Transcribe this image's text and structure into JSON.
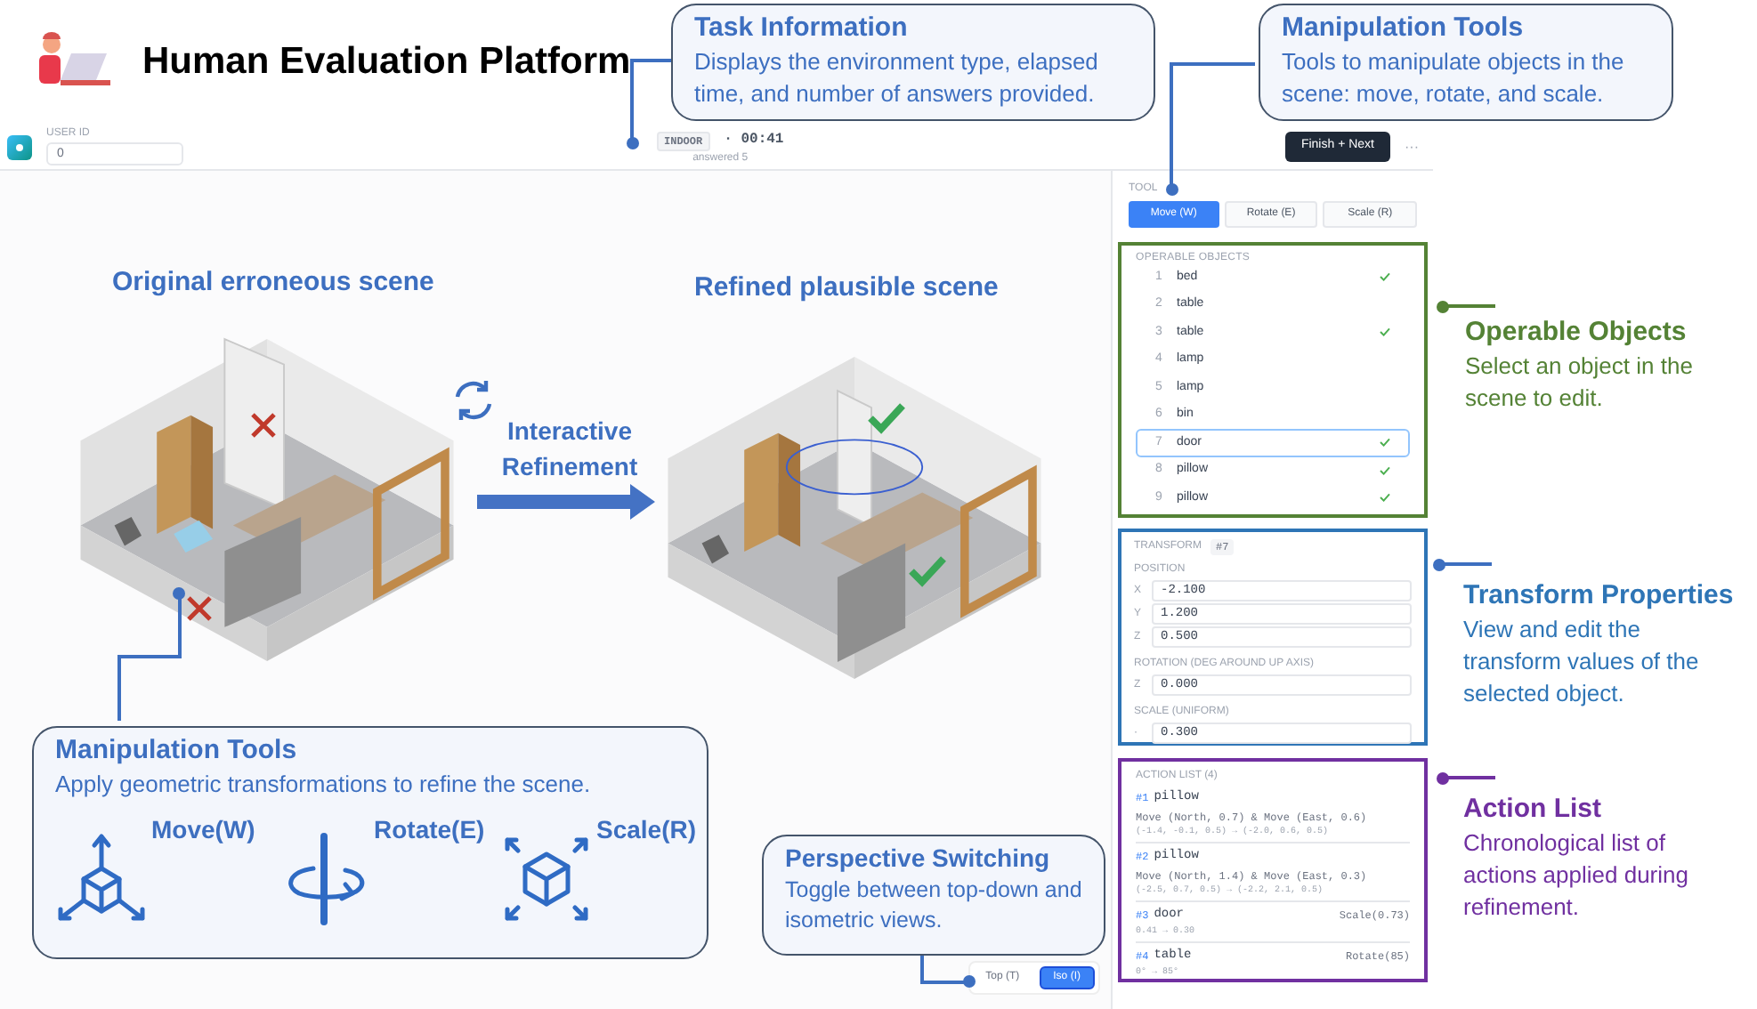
{
  "header": {
    "title": "Human Evaluation Platform"
  },
  "top_bar": {
    "user_id_label": "USER ID",
    "user_id_value": "0",
    "environment": "INDOOR",
    "timer": "· 00:41",
    "answered": "answered 5",
    "finish_button": "Finish + Next",
    "more": "···"
  },
  "scene": {
    "left_title": "Original erroneous scene",
    "right_title": "Refined plausible scene",
    "arrow_label": "Interactive Refinement"
  },
  "view_toggle": [
    {
      "label": "Top",
      "shortcut": "(T)",
      "selected": false
    },
    {
      "label": "Iso",
      "shortcut": "(I)",
      "selected": true
    }
  ],
  "tool": {
    "label": "TOOL",
    "tools": [
      {
        "label": "Move",
        "shortcut": "(W)",
        "selected": true
      },
      {
        "label": "Rotate",
        "shortcut": "(E)",
        "selected": false
      },
      {
        "label": "Scale",
        "shortcut": "(R)",
        "selected": false
      }
    ]
  },
  "objects": {
    "heading": "OPERABLE OBJECTS",
    "items": [
      {
        "index": "1",
        "name": "bed",
        "checked": true,
        "selected": false
      },
      {
        "index": "2",
        "name": "table",
        "checked": false,
        "selected": false
      },
      {
        "index": "3",
        "name": "table",
        "checked": true,
        "selected": false
      },
      {
        "index": "4",
        "name": "lamp",
        "checked": false,
        "selected": false
      },
      {
        "index": "5",
        "name": "lamp",
        "checked": false,
        "selected": false
      },
      {
        "index": "6",
        "name": "bin",
        "checked": false,
        "selected": false
      },
      {
        "index": "7",
        "name": "door",
        "checked": true,
        "selected": true
      },
      {
        "index": "8",
        "name": "pillow",
        "checked": true,
        "selected": false
      },
      {
        "index": "9",
        "name": "pillow",
        "checked": true,
        "selected": false
      }
    ]
  },
  "transform": {
    "label": "TRANSFORM",
    "badge": "#7",
    "position_label": "POSITION",
    "position": [
      {
        "axis": "X",
        "value": "-2.100"
      },
      {
        "axis": "Y",
        "value": "1.200"
      },
      {
        "axis": "Z",
        "value": "0.500"
      }
    ],
    "rotation_label": "ROTATION (DEG AROUND UP AXIS)",
    "rotation": {
      "axis": "Z",
      "value": "0.000"
    },
    "scale_label": "SCALE (UNIFORM)",
    "scale": {
      "axis": "·",
      "value": "0.300"
    }
  },
  "actions": {
    "heading": "ACTION LIST (4)",
    "items": [
      {
        "number": "#1",
        "object": "pillow",
        "detail": "Move (North, 0.7) & Move (East, 0.6)",
        "change": "(-1.4, -0.1, 0.5) → (-2.0, 0.6, 0.5)"
      },
      {
        "number": "#2",
        "object": "pillow",
        "detail": "Move (North, 1.4) & Move (East, 0.3)",
        "change": "(-2.5, 0.7, 0.5) → (-2.2, 2.1, 0.5)"
      },
      {
        "number": "#3",
        "object": "door",
        "operation": "Scale(0.73)",
        "change": "0.41 → 0.30"
      },
      {
        "number": "#4",
        "object": "table",
        "operation": "Rotate(85)",
        "change": "0° → 85°"
      }
    ]
  },
  "callouts": {
    "task_info": {
      "title": "Task Information",
      "text": "Displays the environment type, elapsed time, and number of answers provided."
    },
    "manipulation_panel": {
      "title": "Manipulation Tools",
      "text": "Tools to manipulate objects in the scene: move, rotate, and scale."
    },
    "operable_objects": {
      "title": "Operable Objects",
      "text": "Select an object in the scene to edit."
    },
    "transform_properties": {
      "title": "Transform Properties",
      "text": "View and edit the transform values of the selected object."
    },
    "action_list": {
      "title": "Action List",
      "text": "Chronological list of actions applied during refinement."
    },
    "manipulation_scene": {
      "title": "Manipulation Tools",
      "text": "Apply geometric transformations to refine the scene.",
      "tools": [
        {
          "kind": "move",
          "label": "Move(W)"
        },
        {
          "kind": "rotate",
          "label": "Rotate(E)"
        },
        {
          "kind": "scale",
          "label": "Scale(R)"
        }
      ]
    },
    "perspective": {
      "title": "Perspective Switching",
      "text": "Toggle between top-down and isometric views."
    }
  }
}
